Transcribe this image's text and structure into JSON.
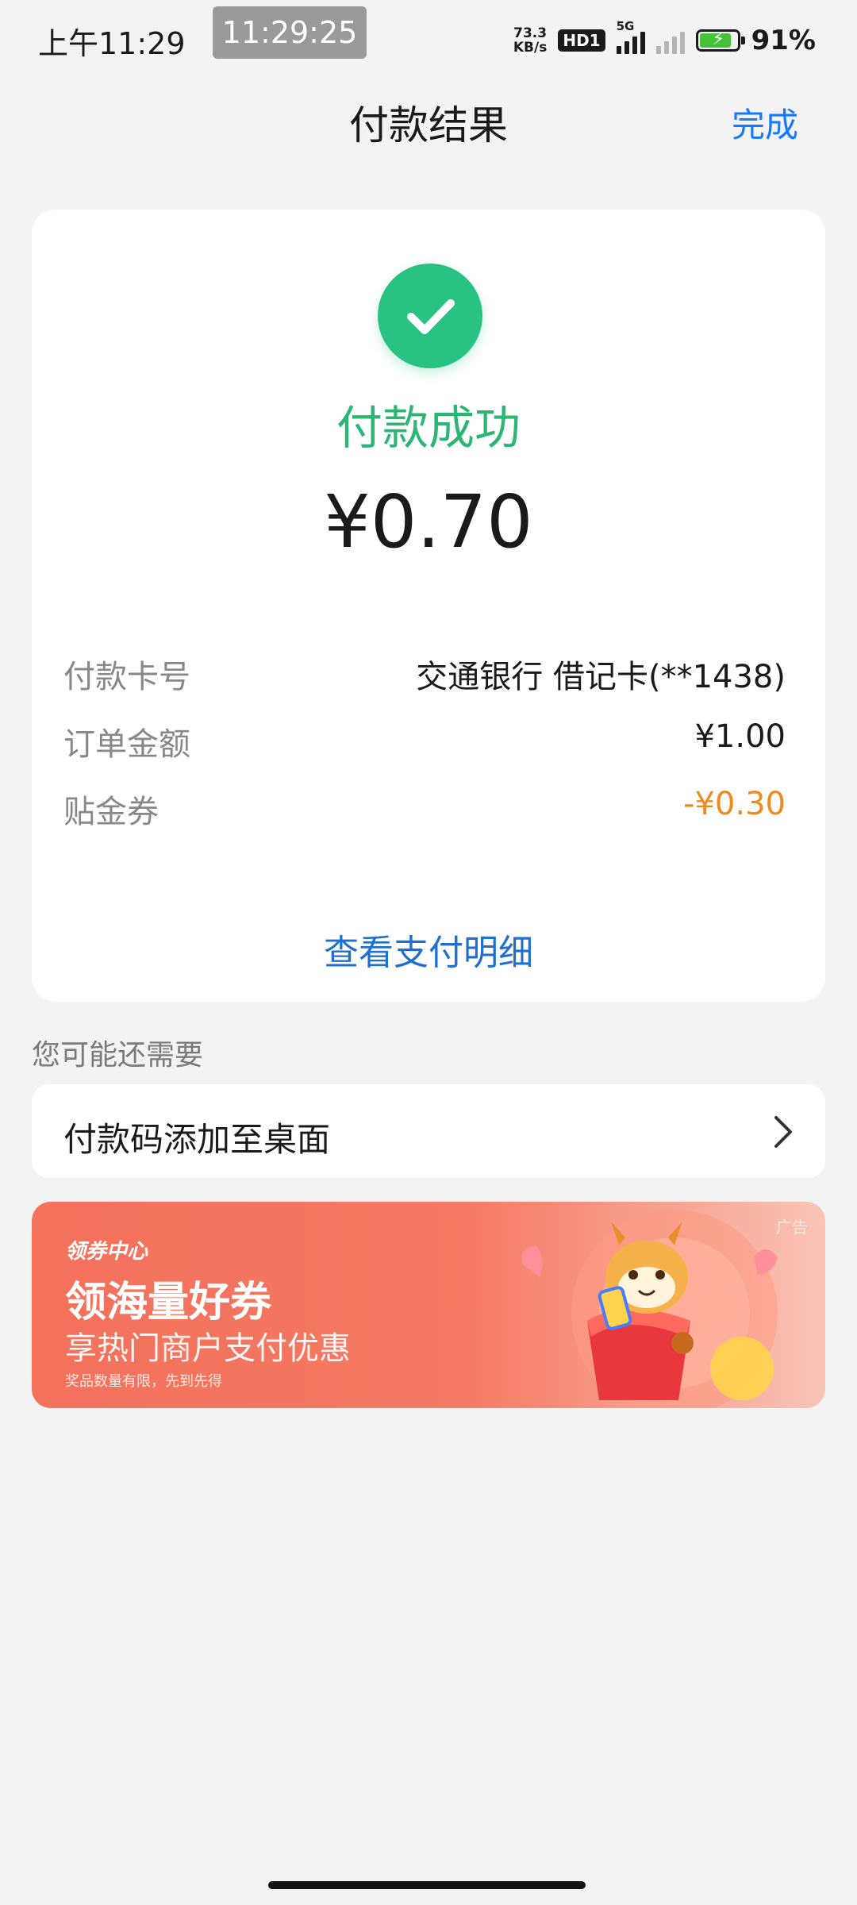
{
  "status_bar": {
    "time": "上午11:29",
    "clock_overlay": "11:29:25",
    "net_speed_value": "73.3",
    "net_speed_unit": "KB/s",
    "hd_badge": "HD1",
    "network_type": "5G",
    "battery_percent": "91%",
    "battery_level": 0.91
  },
  "nav": {
    "title": "付款结果",
    "done_label": "完成"
  },
  "result": {
    "status_text": "付款成功",
    "amount": "¥0.70",
    "rows": [
      {
        "label": "付款卡号",
        "value": "交通银行 借记卡(**1438)"
      },
      {
        "label": "订单金额",
        "value": "¥1.00"
      },
      {
        "label": "贴金券",
        "value": "-¥0.30"
      }
    ],
    "view_details_label": "查看支付明细"
  },
  "suggestions": {
    "section_label": "您可能还需要",
    "items": [
      {
        "label": "付款码添加至桌面"
      }
    ]
  },
  "ad": {
    "tag": "广告",
    "center_label": "领券中心",
    "title": "领海量好券",
    "subtitle": "享热门商户支付优惠",
    "note": "奖品数量有限，先到先得"
  },
  "colors": {
    "success_green": "#28c283",
    "link_blue": "#1677ff",
    "discount_orange": "#f08a1d",
    "ad_red": "#f4715c"
  }
}
